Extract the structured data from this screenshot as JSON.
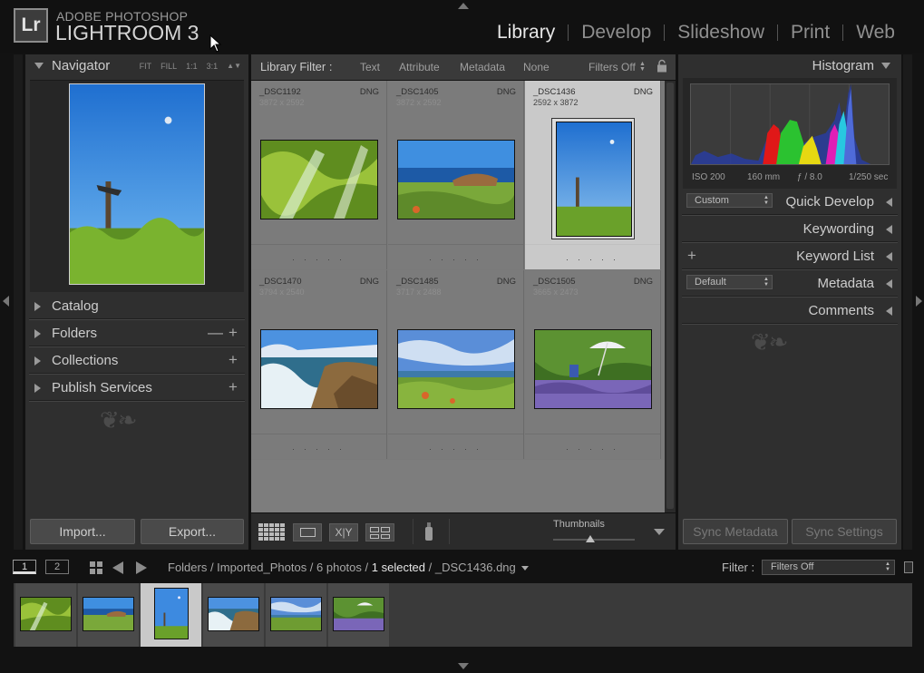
{
  "header": {
    "app_sub": "ADOBE PHOTOSHOP",
    "app_name": "LIGHTROOM 3",
    "logo": "Lr",
    "modules": [
      "Library",
      "Develop",
      "Slideshow",
      "Print",
      "Web"
    ],
    "active_module": "Library"
  },
  "left": {
    "navigator_title": "Navigator",
    "nav_options": [
      "FIT",
      "FILL",
      "1:1",
      "3:1"
    ],
    "sections": [
      "Catalog",
      "Folders",
      "Collections",
      "Publish Services"
    ],
    "import_label": "Import...",
    "export_label": "Export..."
  },
  "filter": {
    "label": "Library Filter :",
    "options": [
      "Text",
      "Attribute",
      "Metadata",
      "None"
    ],
    "status": "Filters Off"
  },
  "grid": [
    {
      "name": "_DSC1192",
      "dims": "3872 x 2592",
      "type": "DNG"
    },
    {
      "name": "_DSC1405",
      "dims": "3872 x 2592",
      "type": "DNG"
    },
    {
      "name": "_DSC1436",
      "dims": "2592 x 3872",
      "type": "DNG"
    },
    {
      "name": "_DSC1470",
      "dims": "3794 x 2540",
      "type": "DNG"
    },
    {
      "name": "_DSC1485",
      "dims": "3717 x 2488",
      "type": "DNG"
    },
    {
      "name": "_DSC1505",
      "dims": "3665 x 2473",
      "type": "DNG"
    }
  ],
  "rating_dots": ". . . . .",
  "toolbar": {
    "thumbnails_label": "Thumbnails",
    "thumbnails_level": 0.45
  },
  "right": {
    "histogram_title": "Histogram",
    "exif": {
      "iso": "ISO 200",
      "focal": "160 mm",
      "aperture": "ƒ / 8.0",
      "shutter": "1/250 sec"
    },
    "quick_develop_preset": "Custom",
    "quick_develop": "Quick Develop",
    "keywording": "Keywording",
    "keyword_list": "Keyword List",
    "metadata_preset": "Default",
    "metadata": "Metadata",
    "comments": "Comments",
    "sync_metadata": "Sync Metadata",
    "sync_settings": "Sync Settings"
  },
  "strip": {
    "page1": "1",
    "page2": "2",
    "path_prefix": "Folders / Imported_Photos / 6 photos /",
    "selected": "1 selected",
    "file": "/ _DSC1436.dng",
    "filter_label": "Filter :",
    "filter_value": "Filters Off"
  }
}
